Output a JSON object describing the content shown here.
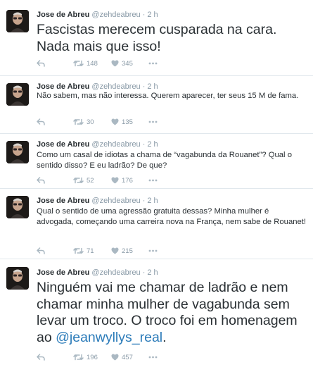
{
  "author": {
    "name": "Jose de Abreu",
    "handle": "@zehdeabreu",
    "separator": "·"
  },
  "tweets": [
    {
      "time": "2 h",
      "text": "Fascistas merecem cusparada na cara. Nada mais que isso!",
      "retweets": "148",
      "likes": "345"
    },
    {
      "time": "2 h",
      "text": "Não sabem, mas não interessa.  Querem aparecer, ter seus 15 M de fama.",
      "retweets": "30",
      "likes": "135"
    },
    {
      "time": "2 h",
      "text": "Como um casal de idiotas a chama de “vagabunda da Rouanet”? Qual o sentido disso? E eu ladrão? De que?",
      "retweets": "52",
      "likes": "176"
    },
    {
      "time": "2 h",
      "text": "Qual o sentido de uma agressão gratuita dessas? Minha mulher é advogada, começando uma carreira nova na França, nem sabe de Rouanet!",
      "retweets": "71",
      "likes": "215"
    },
    {
      "time": "2 h",
      "text": "Ninguém vai me chamar de ladrão e nem chamar minha mulher de vagabunda sem levar um troco. O troco foi em homenagem ao ",
      "mention": "@jeanwyllys_real",
      "tail": ".",
      "retweets": "196",
      "likes": "457"
    }
  ],
  "icons": {
    "reply": "reply-icon",
    "retweet": "retweet-icon",
    "like": "heart-icon",
    "more": "more-dots-icon"
  },
  "colors": {
    "text": "#292f33",
    "meta": "#8899a6",
    "action": "#aab8c2",
    "mention": "#2b7bb9",
    "divider": "#e1e8ed"
  }
}
